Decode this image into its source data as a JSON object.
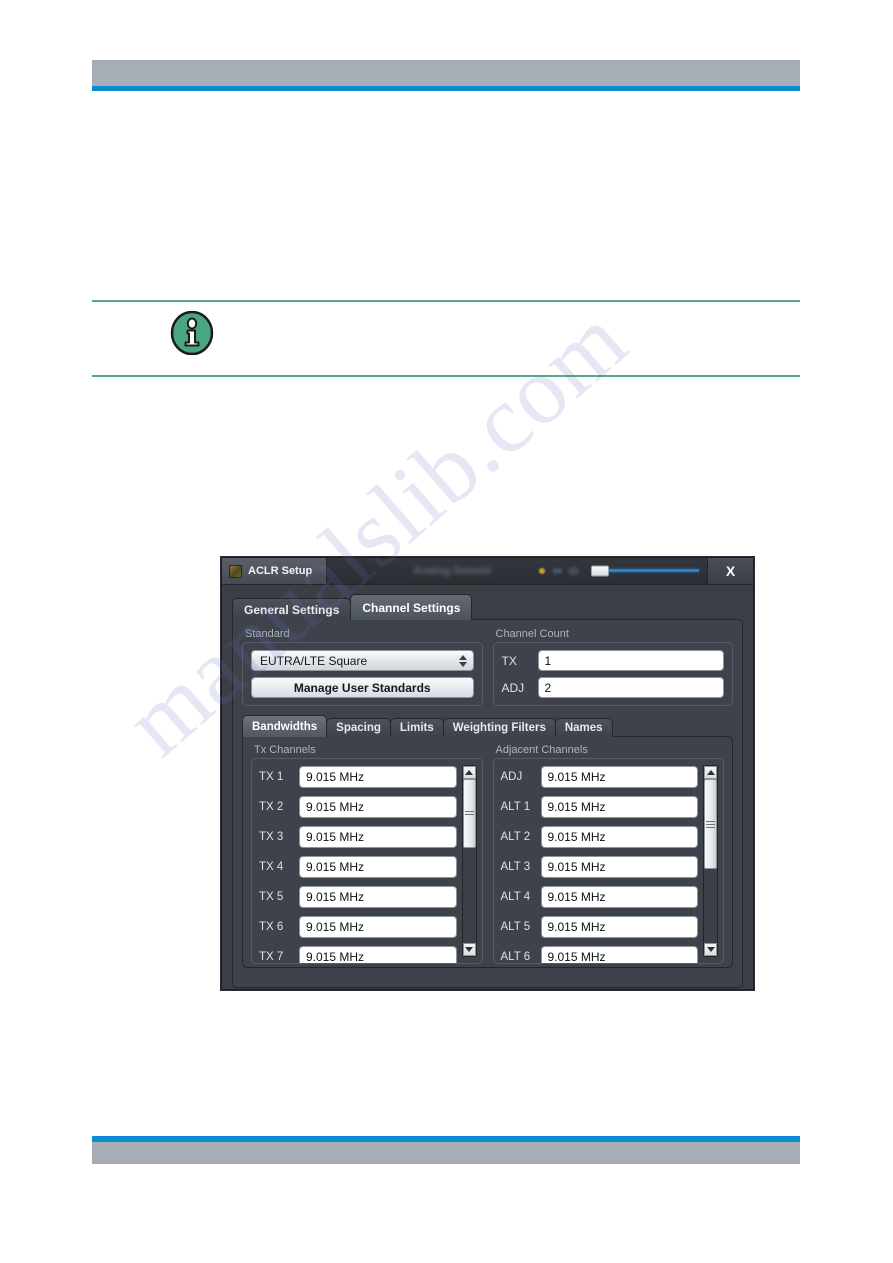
{
  "page": {
    "watermark_text": "manualslib.com",
    "note_icon": "info-icon",
    "header_accent_color": "#0a8cd2",
    "header_bar_color": "#a6adb4",
    "note_rule_color": "#55a887"
  },
  "dialog": {
    "titlebar": {
      "app_icon": "application-icon",
      "title": "ACLR Setup",
      "background_title": "Analog Demod",
      "close_label": "X"
    },
    "tabs": [
      {
        "label": "General Settings",
        "active": false
      },
      {
        "label": "Channel Settings",
        "active": true
      }
    ],
    "standard": {
      "group_label": "Standard",
      "selected": "EUTRA/LTE Square",
      "manage_button": "Manage User Standards"
    },
    "channel_count": {
      "group_label": "Channel Count",
      "fields": [
        {
          "label": "TX",
          "value": "1"
        },
        {
          "label": "ADJ",
          "value": "2"
        }
      ]
    },
    "subtabs": [
      {
        "label": "Bandwidths",
        "active": true
      },
      {
        "label": "Spacing",
        "active": false
      },
      {
        "label": "Limits",
        "active": false
      },
      {
        "label": "Weighting Filters",
        "active": false
      },
      {
        "label": "Names",
        "active": false
      }
    ],
    "tx_channels": {
      "group_label": "Tx Channels",
      "items": [
        {
          "label": "TX 1",
          "value": "9.015 MHz"
        },
        {
          "label": "TX 2",
          "value": "9.015 MHz"
        },
        {
          "label": "TX 3",
          "value": "9.015 MHz"
        },
        {
          "label": "TX 4",
          "value": "9.015 MHz"
        },
        {
          "label": "TX 5",
          "value": "9.015 MHz"
        },
        {
          "label": "TX 6",
          "value": "9.015 MHz"
        },
        {
          "label": "TX 7",
          "value": "9.015 MHz"
        }
      ],
      "scroll": {
        "thumb_top_pct": 0,
        "thumb_height_pct": 42
      }
    },
    "adjacent_channels": {
      "group_label": "Adjacent Channels",
      "items": [
        {
          "label": "ADJ",
          "value": "9.015 MHz"
        },
        {
          "label": "ALT 1",
          "value": "9.015 MHz"
        },
        {
          "label": "ALT 2",
          "value": "9.015 MHz"
        },
        {
          "label": "ALT 3",
          "value": "9.015 MHz"
        },
        {
          "label": "ALT 4",
          "value": "9.015 MHz"
        },
        {
          "label": "ALT 5",
          "value": "9.015 MHz"
        },
        {
          "label": "ALT 6",
          "value": "9.015 MHz"
        }
      ],
      "scroll": {
        "thumb_top_pct": 0,
        "thumb_height_pct": 55
      }
    }
  }
}
